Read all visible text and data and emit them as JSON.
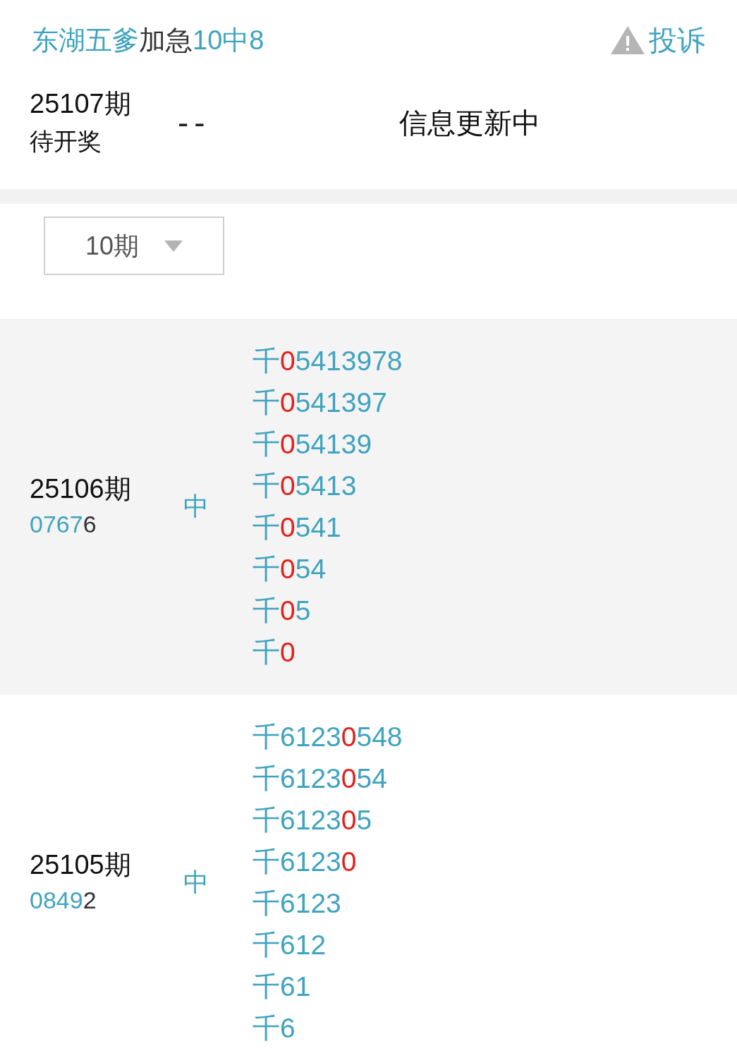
{
  "header": {
    "title": [
      {
        "text": "东湖五爹",
        "highlight": true
      },
      {
        "text": "加急",
        "highlight": false
      },
      {
        "text": "10中8",
        "highlight": true
      }
    ],
    "complaint_link": "投诉"
  },
  "current_issue": {
    "issue": "25107期",
    "status": "待开奖",
    "result": "--",
    "message": "信息更新中"
  },
  "period_select": {
    "value": "10期"
  },
  "results": [
    {
      "issue": "25106期",
      "draw": [
        {
          "text": "0767",
          "highlight": true
        },
        {
          "text": "6",
          "highlight": false
        }
      ],
      "outcome": "中",
      "predictions": [
        {
          "segments": [
            {
              "text": "千",
              "hit": false
            },
            {
              "text": "0",
              "hit": true
            },
            {
              "text": "5413978",
              "hit": false
            }
          ]
        },
        {
          "segments": [
            {
              "text": "千",
              "hit": false
            },
            {
              "text": "0",
              "hit": true
            },
            {
              "text": "541397",
              "hit": false
            }
          ]
        },
        {
          "segments": [
            {
              "text": "千",
              "hit": false
            },
            {
              "text": "0",
              "hit": true
            },
            {
              "text": "54139",
              "hit": false
            }
          ]
        },
        {
          "segments": [
            {
              "text": "千",
              "hit": false
            },
            {
              "text": "0",
              "hit": true
            },
            {
              "text": "5413",
              "hit": false
            }
          ]
        },
        {
          "segments": [
            {
              "text": "千",
              "hit": false
            },
            {
              "text": "0",
              "hit": true
            },
            {
              "text": "541",
              "hit": false
            }
          ]
        },
        {
          "segments": [
            {
              "text": "千",
              "hit": false
            },
            {
              "text": "0",
              "hit": true
            },
            {
              "text": "54",
              "hit": false
            }
          ]
        },
        {
          "segments": [
            {
              "text": "千",
              "hit": false
            },
            {
              "text": "0",
              "hit": true
            },
            {
              "text": "5",
              "hit": false
            }
          ]
        },
        {
          "segments": [
            {
              "text": "千",
              "hit": false
            },
            {
              "text": "0",
              "hit": true
            }
          ]
        }
      ]
    },
    {
      "issue": "25105期",
      "draw": [
        {
          "text": "0849",
          "highlight": true
        },
        {
          "text": "2",
          "highlight": false
        }
      ],
      "outcome": "中",
      "predictions": [
        {
          "segments": [
            {
              "text": "千6123",
              "hit": false
            },
            {
              "text": "0",
              "hit": true
            },
            {
              "text": "548",
              "hit": false
            }
          ]
        },
        {
          "segments": [
            {
              "text": "千6123",
              "hit": false
            },
            {
              "text": "0",
              "hit": true
            },
            {
              "text": "54",
              "hit": false
            }
          ]
        },
        {
          "segments": [
            {
              "text": "千6123",
              "hit": false
            },
            {
              "text": "0",
              "hit": true
            },
            {
              "text": "5",
              "hit": false
            }
          ]
        },
        {
          "segments": [
            {
              "text": "千6123",
              "hit": false
            },
            {
              "text": "0",
              "hit": true
            }
          ]
        },
        {
          "segments": [
            {
              "text": "千6123",
              "hit": false
            }
          ]
        },
        {
          "segments": [
            {
              "text": "千612",
              "hit": false
            }
          ]
        },
        {
          "segments": [
            {
              "text": "千61",
              "hit": false
            }
          ]
        },
        {
          "segments": [
            {
              "text": "千6",
              "hit": false
            }
          ]
        }
      ]
    }
  ]
}
